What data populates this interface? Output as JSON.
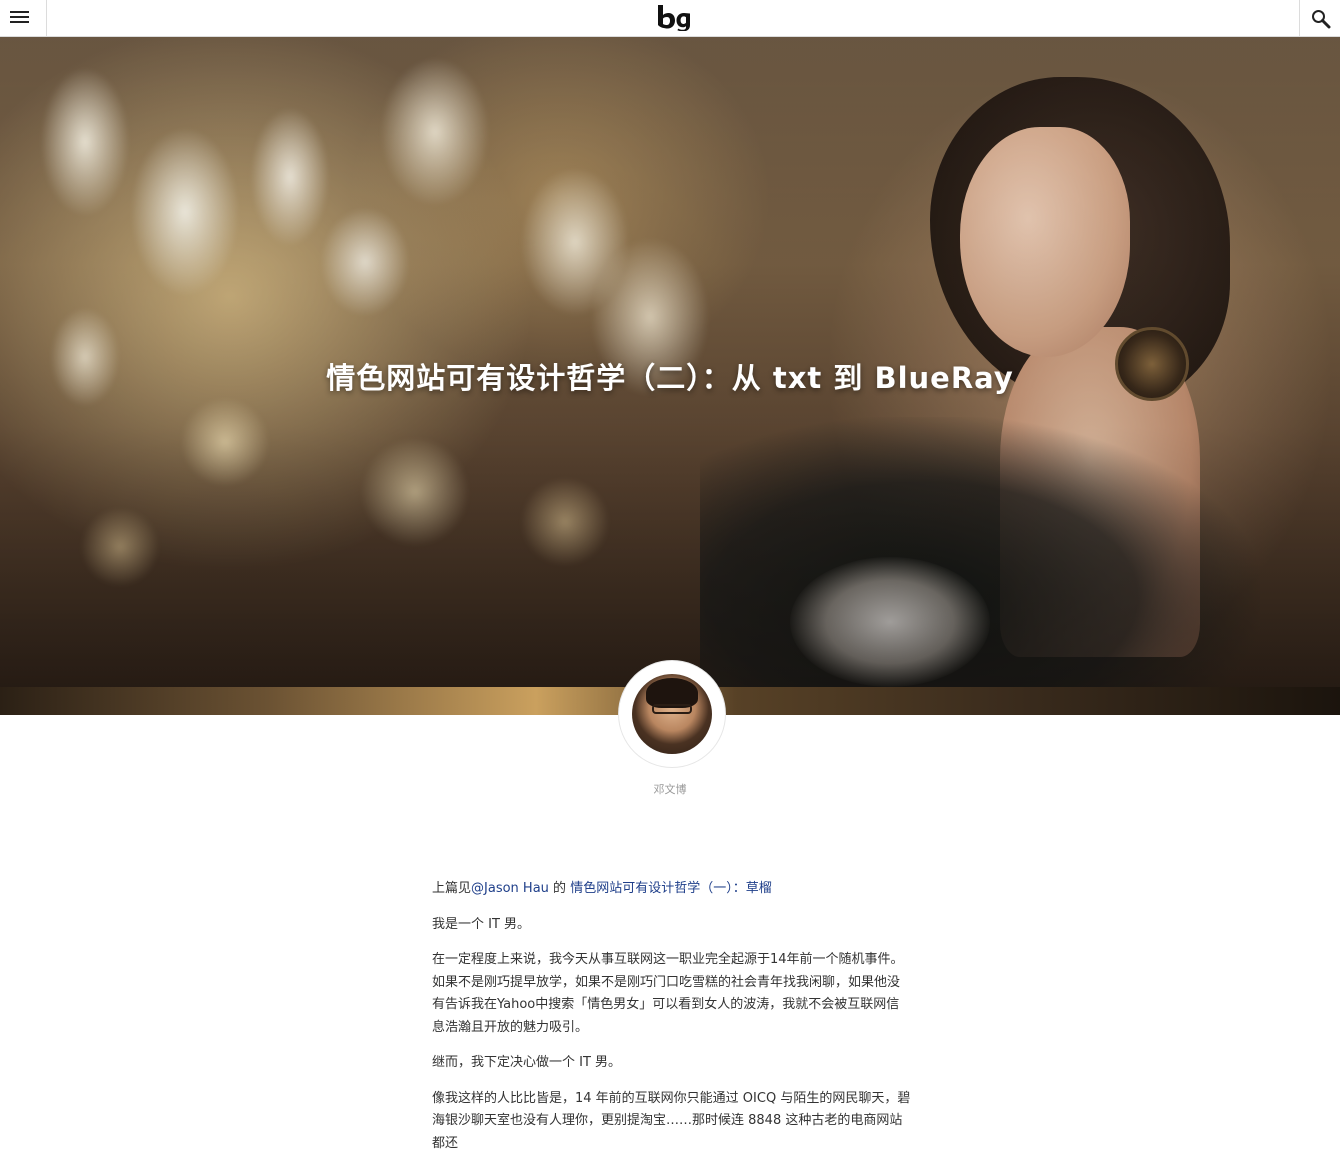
{
  "site": {
    "logo_text": "bg"
  },
  "hero": {
    "title": "情色网站可有设计哲学（二）：从 txt 到 BlueRay"
  },
  "author": {
    "name": "邓文博"
  },
  "article": {
    "intro_prefix": "上篇见",
    "intro_link_author": "@Jason Hau",
    "intro_middle": " 的",
    "intro_link_title": "情色网站可有设计哲学（一）：草榴",
    "paragraphs": [
      "我是一个 IT 男。",
      "在一定程度上来说，我今天从事互联网这一职业完全起源于14年前一个随机事件。如果不是刚巧提早放学，如果不是刚巧门口吃雪糕的社会青年找我闲聊，如果他没有告诉我在Yahoo中搜索「情色男女」可以看到女人的波涛，我就不会被互联网信息浩瀚且开放的魅力吸引。",
      "继而，我下定决心做一个 IT 男。",
      "像我这样的人比比皆是，14 年前的互联网你只能通过 OICQ 与陌生的网民聊天，碧海银沙聊天室也没有人理你，更别提淘宝……那时候连 8848 这种古老的电商网站都还"
    ]
  }
}
